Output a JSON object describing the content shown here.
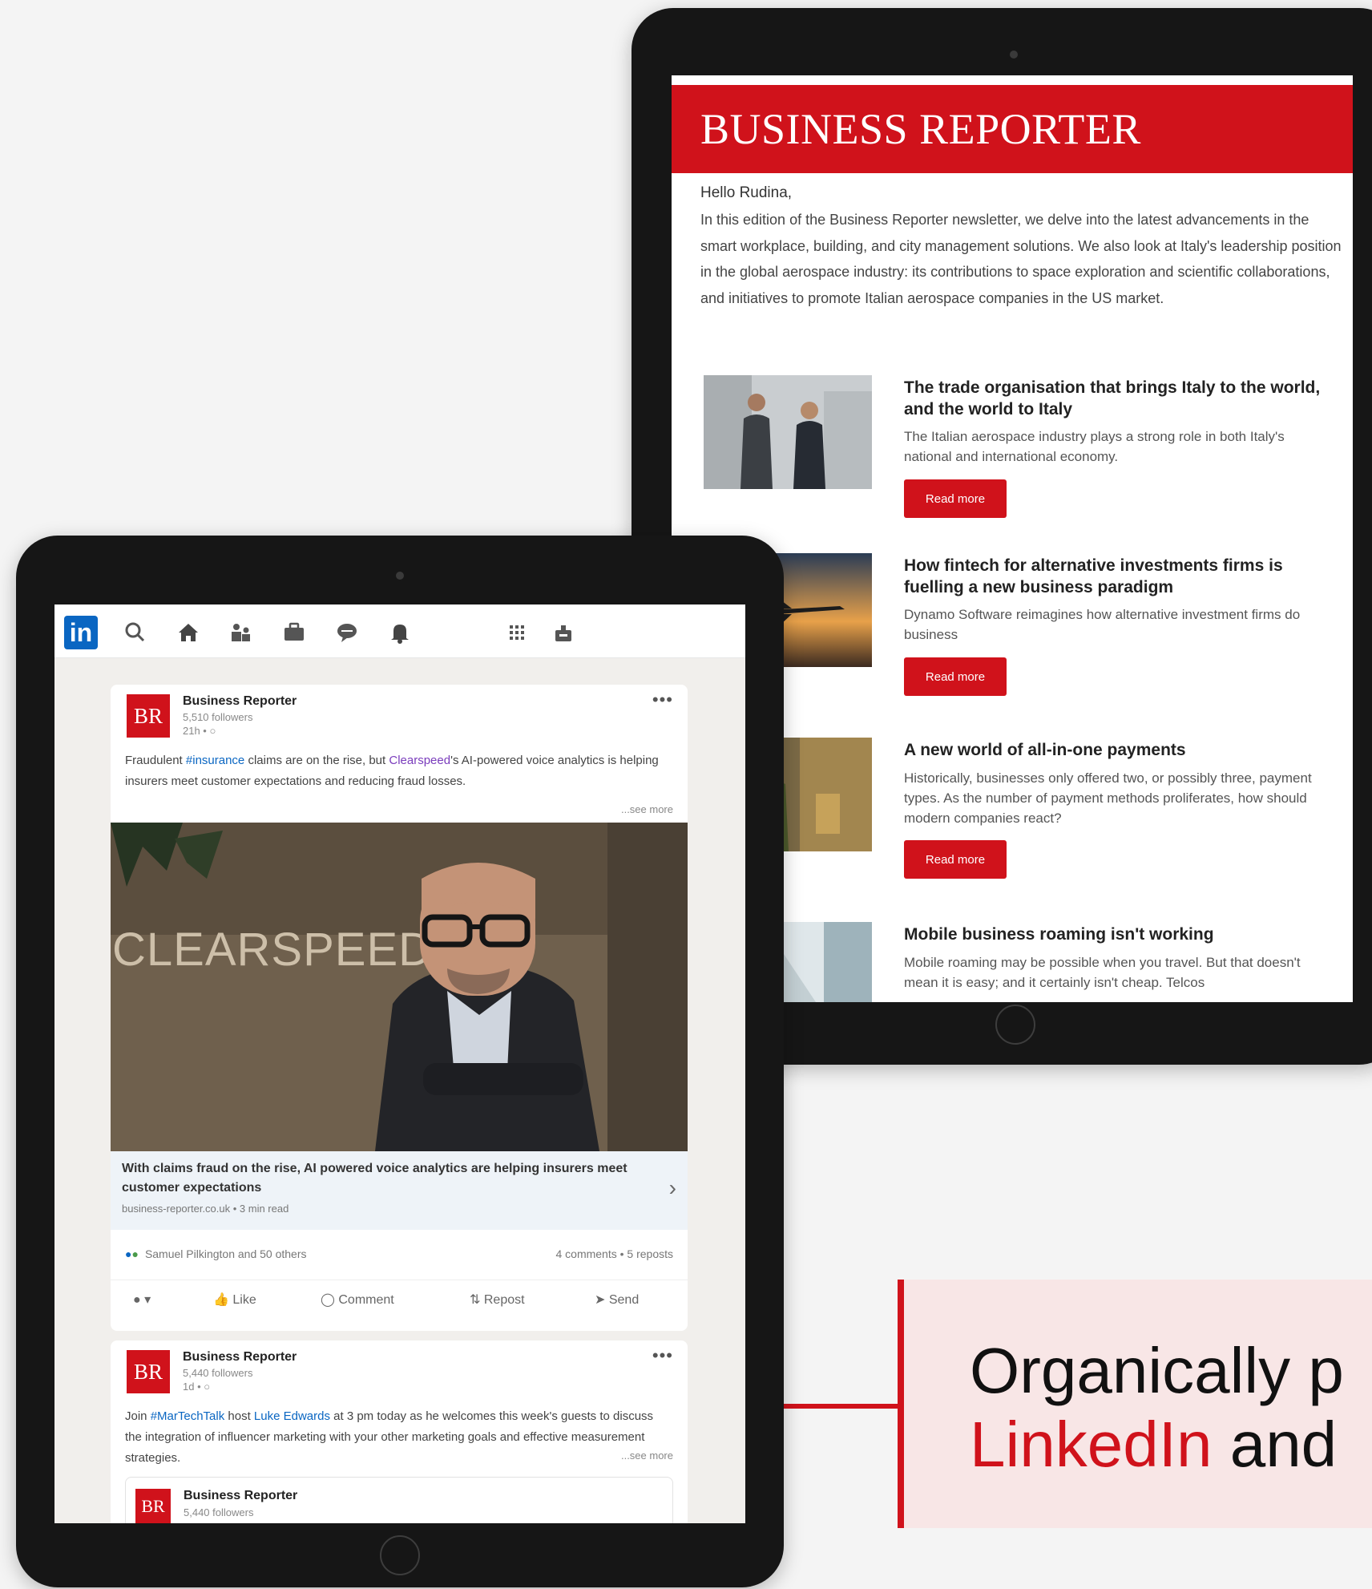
{
  "newsletter": {
    "brand": "BUSINESS REPORTER",
    "greeting": "Hello Rudina,",
    "intro": "In this edition of the Business Reporter newsletter, we delve into the latest advancements in the smart workplace, building, and city management solutions. We also look at Italy's leadership position in the global aerospace industry: its contributions to space exploration and scientific collaborations, and initiatives to promote Italian aerospace companies in the US market.",
    "read_more": "Read more",
    "articles": [
      {
        "title": "The trade organisation that brings Italy to the world, and the world to Italy",
        "desc": "The Italian aerospace industry plays a strong role in both Italy's national and international economy."
      },
      {
        "title": "How fintech for alternative investments firms is fuelling a new business paradigm",
        "desc": "Dynamo Software reimagines how alternative investment firms do business"
      },
      {
        "title": "A new world of all-in-one payments",
        "desc": "Historically, businesses only offered two, or possibly three, payment types. As the number of payment methods proliferates, how should modern companies react?"
      },
      {
        "title": "Mobile business roaming isn't working",
        "desc": "Mobile roaming may be possible when you travel. But that doesn't mean it is easy; and it certainly isn't cheap. Telcos"
      }
    ]
  },
  "linkedin": {
    "logo": "in",
    "post1": {
      "logo": "BR",
      "name": "Business Reporter",
      "followers": "5,510 followers",
      "time": "21h • ",
      "more": "•••",
      "text_pre": "Fraudulent ",
      "hashtag": "#insurance",
      "text_mid": " claims are on the rise, but ",
      "mention": "Clearspeed",
      "text_post": "'s AI-powered voice analytics is helping insurers meet customer expectations and reducing fraud losses.",
      "see_more": "...see more",
      "photo_text": "CLEARSPEED",
      "link_title": "With claims fraud on the rise, AI powered voice analytics are helping insurers meet customer expectations",
      "link_source": "business-reporter.co.uk • 3 min read",
      "reactions": "Samuel Pilkington and 50 others",
      "counts": "4 comments • 5 reposts",
      "actions": {
        "like": "Like",
        "comment": "Comment",
        "repost": "Repost",
        "send": "Send"
      }
    },
    "post2": {
      "logo": "BR",
      "name": "Business Reporter",
      "followers": "5,440 followers",
      "time": "1d • ",
      "more": "•••",
      "text_pre": "Join ",
      "hashtag": "#MarTechTalk",
      "text_mid": " host ",
      "mention": "Luke Edwards",
      "text_post": " at 3 pm today as he welcomes this week's guests to discuss the integration of influencer marketing with your other marketing goals and effective measurement strategies.",
      "see_more": "...see more"
    },
    "post3": {
      "logo": "BR",
      "name": "Business Reporter",
      "followers": "5,440 followers"
    }
  },
  "callout": {
    "line1": "Organically p",
    "line2_accent": "LinkedIn",
    "line2_rest": " and"
  },
  "colors": {
    "brand_red": "#d0121b",
    "linkedin_blue": "#0a66c2",
    "callout_bg": "#f8e6e6"
  }
}
